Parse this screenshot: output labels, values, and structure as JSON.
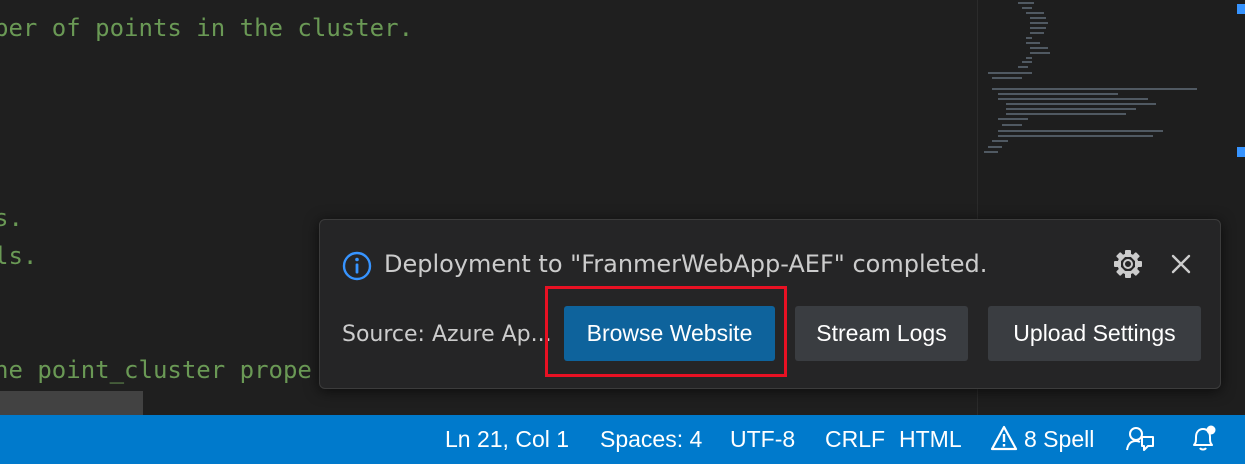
{
  "editor": {
    "code_lines": [
      "ber of points in the cluster.",
      "s.",
      "ls.",
      "he point_cluster prope"
    ]
  },
  "notification": {
    "message": "Deployment to \"FranmerWebApp-AEF\" completed.",
    "source": "Source: Azure Ap...",
    "buttons": {
      "browse": "Browse Website",
      "stream": "Stream Logs",
      "upload": "Upload Settings"
    }
  },
  "statusbar": {
    "position": "Ln 21, Col 1",
    "spaces": "Spaces: 4",
    "encoding": "UTF-8",
    "eol": "CRLF",
    "language": "HTML",
    "spell": "8 Spell"
  },
  "colors": {
    "accent": "#007acc",
    "primary_button": "#0e639c",
    "highlight": "#e81123"
  },
  "icons": [
    "info-icon",
    "gear-icon",
    "close-icon",
    "warning-icon",
    "feedback-icon",
    "bell-icon"
  ]
}
